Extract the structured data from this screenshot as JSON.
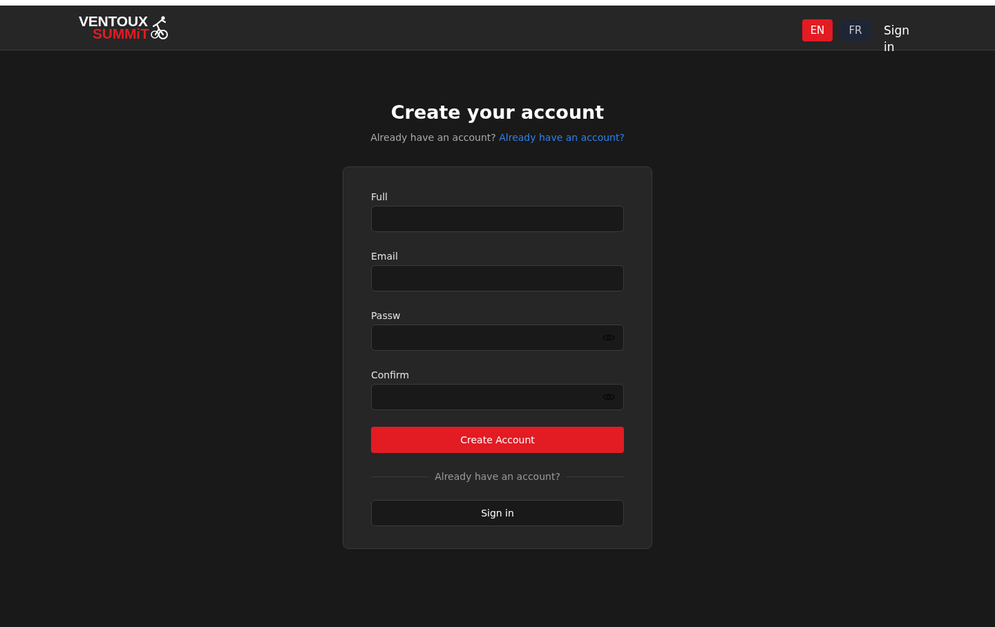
{
  "header": {
    "logo": {
      "line_1": "VENTOUX",
      "line_2": "SUMMiT"
    },
    "languages": [
      {
        "label": "EN",
        "selected": true
      },
      {
        "label": "FR",
        "selected": false
      }
    ],
    "sign_in_link": "Sign in"
  },
  "page": {
    "title": "Create your account",
    "subtitle": {
      "text": "Already have an account?",
      "link": "Already have an account?"
    }
  },
  "form": {
    "fields": [
      {
        "label": "Full",
        "kind": "text"
      },
      {
        "label": "Email",
        "kind": "text"
      },
      {
        "label": "Passw",
        "kind": "password"
      },
      {
        "label": "Confirm",
        "kind": "password"
      }
    ],
    "submit_button": "Create Account",
    "divider_text": "Already have an account?",
    "secondary_button": "Sign in"
  }
}
